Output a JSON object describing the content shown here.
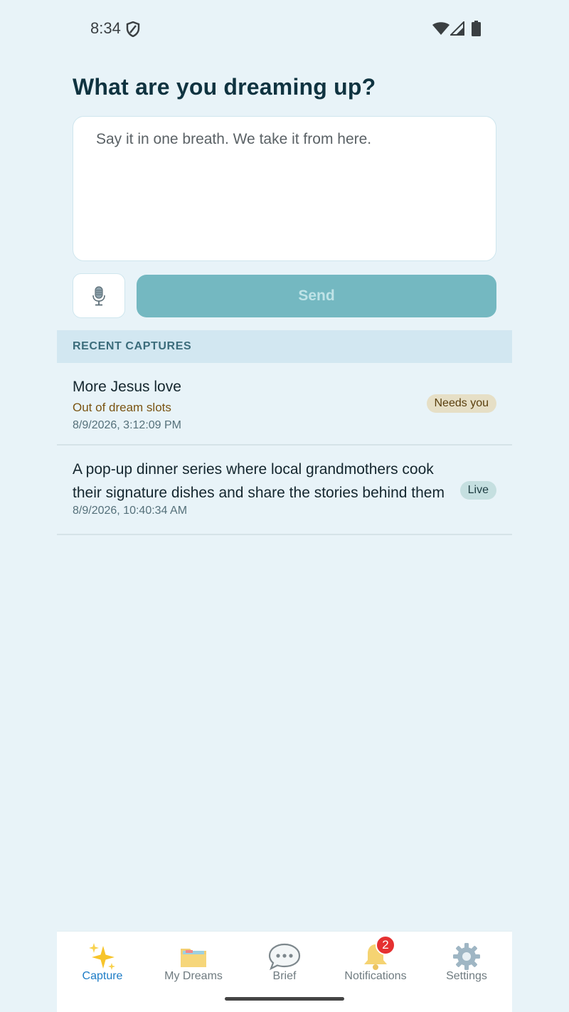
{
  "status_bar": {
    "time": "8:34",
    "icons": [
      "shield-icon",
      "wifi-icon",
      "signal-icon",
      "battery-icon"
    ]
  },
  "capture": {
    "title": "What are you dreaming up?",
    "input_placeholder": "Say it in one breath. We take it from here.",
    "input_value": "",
    "mic_icon": "microphone-icon",
    "send_label": "Send"
  },
  "recent": {
    "header": "RECENT CAPTURES",
    "items": [
      {
        "title": "More Jesus love",
        "subtitle": "Out of dream slots",
        "timestamp": "8/9/2026, 3:12:09 PM",
        "badge": "Needs you"
      },
      {
        "title": "A pop-up dinner series where local grandmothers cook their signature dishes and share the stories behind them",
        "timestamp": "8/9/2026, 10:40:34 AM",
        "badge": "Live"
      }
    ]
  },
  "nav": {
    "tabs": [
      {
        "label": "Capture",
        "icon": "sparkles-icon",
        "active": true
      },
      {
        "label": "My Dreams",
        "icon": "folder-icon",
        "active": false
      },
      {
        "label": "Brief",
        "icon": "speech-bubble-icon",
        "active": false
      },
      {
        "label": "Notifications",
        "icon": "bell-icon",
        "active": false,
        "badge": "2"
      },
      {
        "label": "Settings",
        "icon": "gear-icon",
        "active": false
      }
    ]
  },
  "colors": {
    "background": "#e8f3f8",
    "title": "#0f3340",
    "send_button": "#74b8c1",
    "active_tab": "#1d7cc6",
    "needs_badge": "#e6dfc6",
    "live_badge": "#c5dfe0",
    "notification_badge": "#e53131"
  }
}
